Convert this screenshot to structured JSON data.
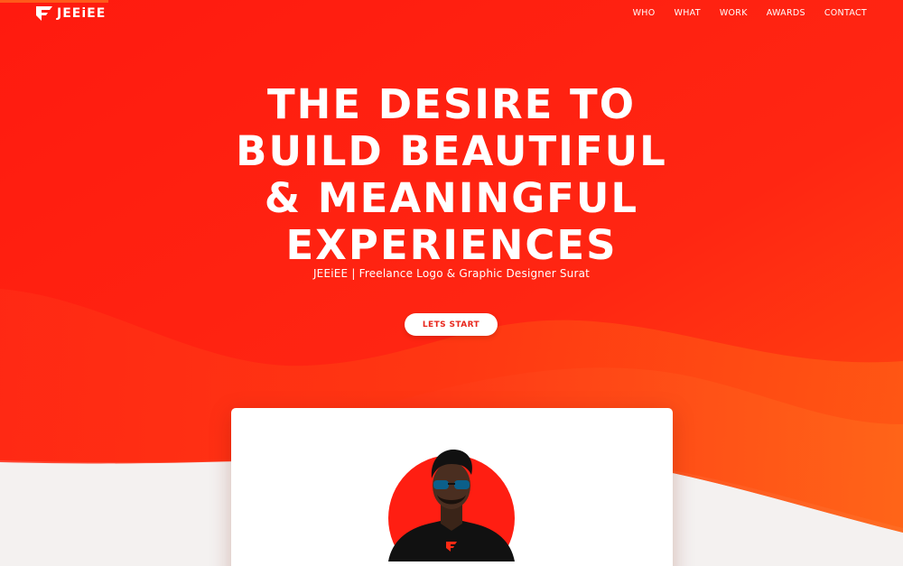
{
  "brand": {
    "logo_text": "JEEiEE",
    "accent_color": "#ff2a14",
    "secondary_color": "#ff5a1a"
  },
  "nav": {
    "items": [
      {
        "label": "WHO"
      },
      {
        "label": "WHAT"
      },
      {
        "label": "WORK"
      },
      {
        "label": "AWARDS"
      },
      {
        "label": "CONTACT"
      }
    ]
  },
  "hero": {
    "headline_lines": [
      "THE DESIRE TO",
      "BUILD BEAUTIFUL",
      "& MEANINGFUL",
      "EXPERIENCES"
    ],
    "subtitle": "JEEiEE | Freelance Logo & Graphic Designer Surat",
    "cta_label": "LETS START"
  },
  "card": {
    "portrait_icon": "designer-portrait"
  }
}
